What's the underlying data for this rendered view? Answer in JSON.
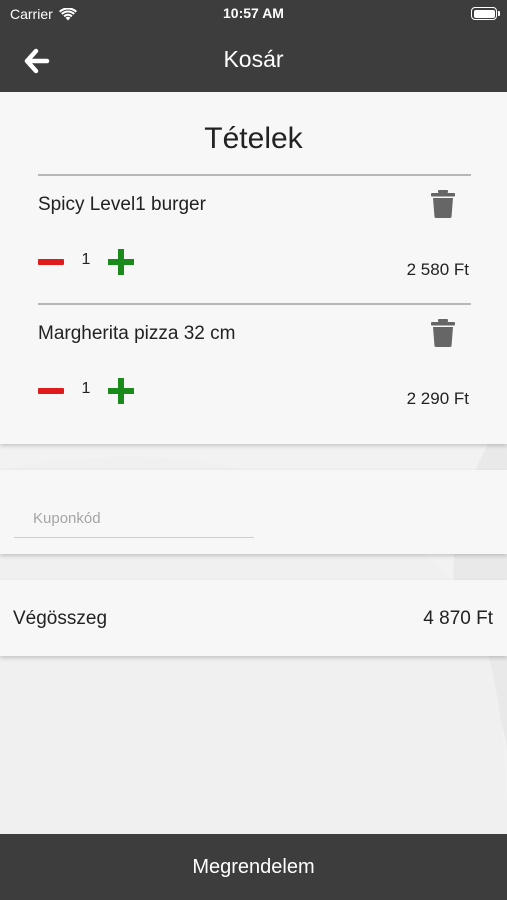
{
  "status_bar": {
    "carrier": "Carrier",
    "time": "10:57 AM"
  },
  "nav": {
    "title": "Kosár",
    "back_icon": "arrow-left-icon"
  },
  "items_section": {
    "heading": "Tételek",
    "items": [
      {
        "name": "Spicy Level1 burger",
        "quantity": "1",
        "price": "2 580 Ft"
      },
      {
        "name": "Margherita pizza 32 cm",
        "quantity": "1",
        "price": "2 290 Ft"
      }
    ]
  },
  "coupon": {
    "placeholder": "Kuponkód",
    "value": ""
  },
  "total": {
    "label": "Végösszeg",
    "value": "4 870 Ft"
  },
  "order_button": {
    "label": "Megrendelem"
  },
  "colors": {
    "bar": "#3d3d3d",
    "minus": "#e01b1b",
    "plus": "#1a8a1a",
    "trash": "#666666"
  }
}
